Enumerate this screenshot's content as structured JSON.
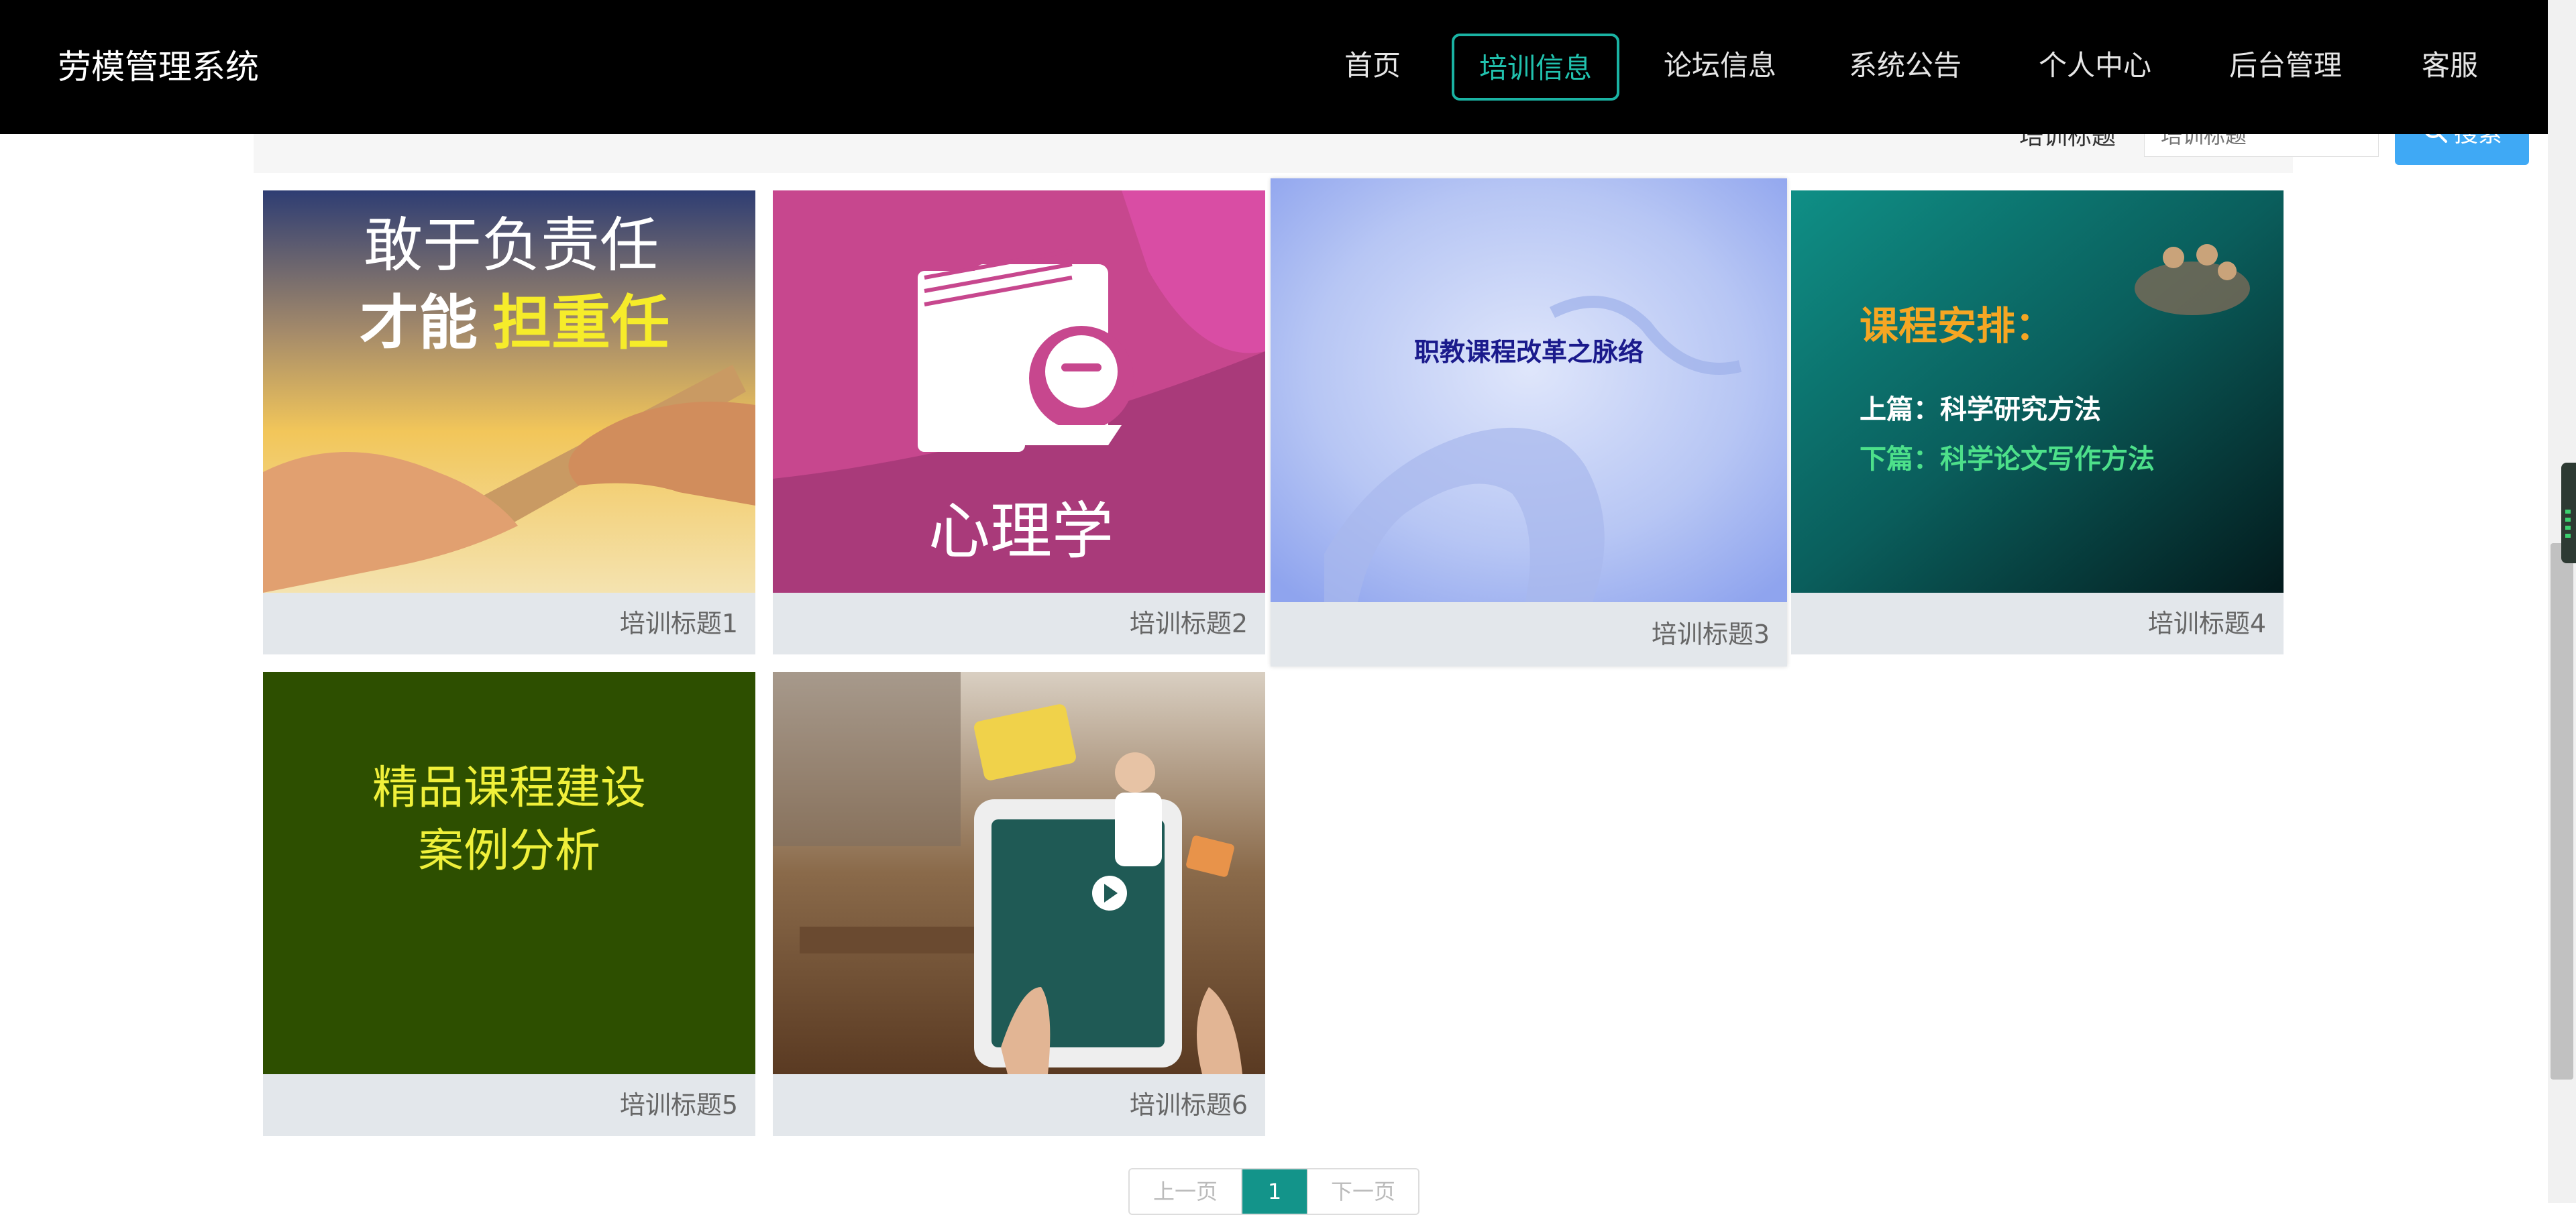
{
  "header": {
    "brand": "劳模管理系统",
    "nav": [
      {
        "label": "首页",
        "active": false
      },
      {
        "label": "培训信息",
        "active": true
      },
      {
        "label": "论坛信息",
        "active": false
      },
      {
        "label": "系统公告",
        "active": false
      },
      {
        "label": "个人中心",
        "active": false
      },
      {
        "label": "后台管理",
        "active": false
      },
      {
        "label": "客服",
        "active": false
      }
    ]
  },
  "search": {
    "label": "培训标题",
    "placeholder": "培训标题",
    "button_label": "搜索",
    "button_icon": "search-icon"
  },
  "cards": [
    {
      "title": "培训标题1",
      "image_text": [
        "敢于负责任",
        "才能",
        "担重任"
      ]
    },
    {
      "title": "培训标题2",
      "image_text": [
        "心理学"
      ]
    },
    {
      "title": "培训标题3",
      "image_text": [
        "职教课程改革之脉络"
      ]
    },
    {
      "title": "培训标题4",
      "image_text": [
        "课程安排：",
        "上篇：科学研究方法",
        "下篇：科学论文写作方法"
      ]
    },
    {
      "title": "培训标题5",
      "image_text": [
        "精品课程建设",
        "案例分析"
      ]
    },
    {
      "title": "培训标题6",
      "image_text": []
    }
  ],
  "pagination": {
    "prev_label": "上一页",
    "current_page": "1",
    "next_label": "下一页"
  },
  "colors": {
    "header_bg": "#000000",
    "accent": "#1ab3a3",
    "search_button": "#3fa9f5",
    "pager_active": "#13948a",
    "caption_bg": "#e3e7eb"
  }
}
